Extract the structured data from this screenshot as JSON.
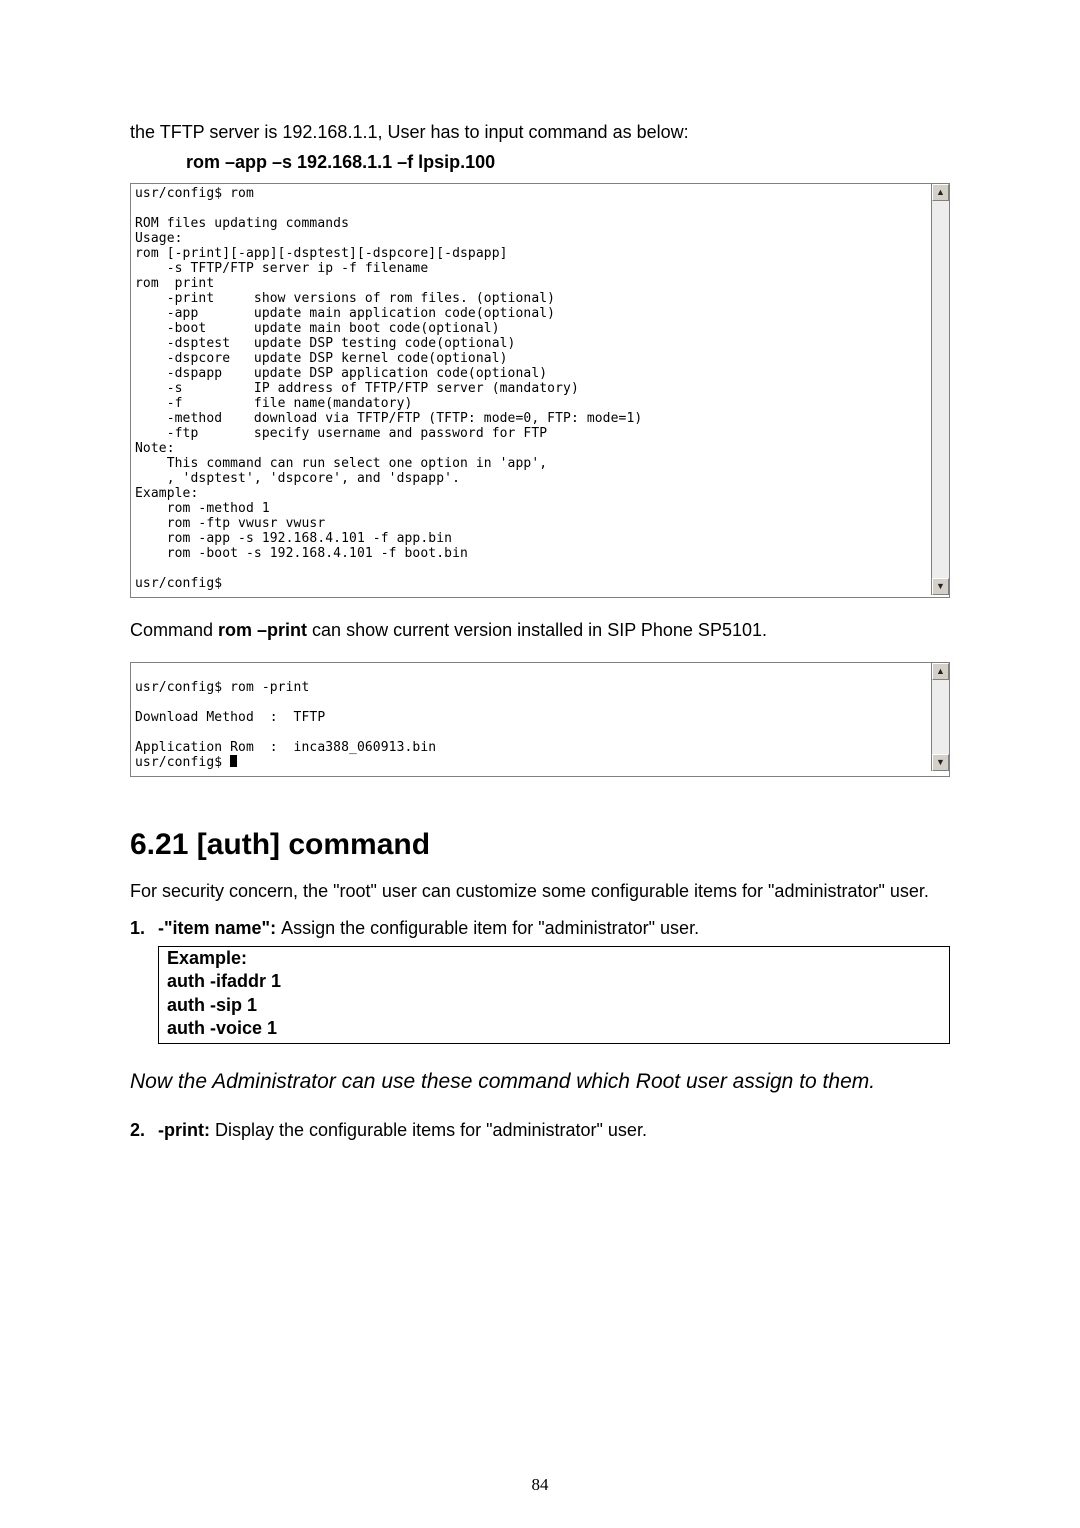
{
  "intro_text": "the TFTP server is 192.168.1.1, User has to input command as below:",
  "cmd_example": "rom –app –s 192.168.1.1 –f lpsip.100",
  "terminal1": "usr/config$ rom\n\nROM files updating commands\nUsage:\nrom [-print][-app][-dsptest][-dspcore][-dspapp]\n    -s TFTP/FTP server ip -f filename\nrom  print\n    -print     show versions of rom files. (optional)\n    -app       update main application code(optional)\n    -boot      update main boot code(optional)\n    -dsptest   update DSP testing code(optional)\n    -dspcore   update DSP kernel code(optional)\n    -dspapp    update DSP application code(optional)\n    -s         IP address of TFTP/FTP server (mandatory)\n    -f         file name(mandatory)\n    -method    download via TFTP/FTP (TFTP: mode=0, FTP: mode=1)\n    -ftp       specify username and password for FTP\nNote:\n    This command can run select one option in 'app',\n    , 'dsptest', 'dspcore', and 'dspapp'.\nExample:\n    rom -method 1\n    rom -ftp vwusr vwusr\n    rom -app -s 192.168.4.101 -f app.bin\n    rom -boot -s 192.168.4.101 -f boot.bin\n\nusr/config$",
  "para2_pre": "Command ",
  "para2_bold": "rom –print",
  "para2_post": " can show current version installed in SIP Phone SP5101.",
  "terminal2": "\nusr/config$ rom -print\n\nDownload Method  :  TFTP\n\nApplication Rom  :  inca388_060913.bin\nusr/config$ ",
  "section_heading": "6.21    [auth] command",
  "body1": "For security concern, the \"root\" user can customize some configurable items for \"administrator\" user.",
  "list1_num": "1.",
  "list1_head": "-\"item name\": ",
  "list1_body": "Assign the configurable item for \"administrator\" user.",
  "example": {
    "title": "Example:",
    "l1": "auth -ifaddr 1",
    "l2": "auth -sip 1",
    "l3": "auth -voice 1"
  },
  "italic_note": "Now the Administrator can use these command which Root user assign to them.",
  "list2_num": "2.",
  "list2_head": "-print: ",
  "list2_body": "Display the configurable items for \"administrator\" user.",
  "page_number": "84",
  "icons": {
    "up": "▲",
    "down": "▼"
  }
}
